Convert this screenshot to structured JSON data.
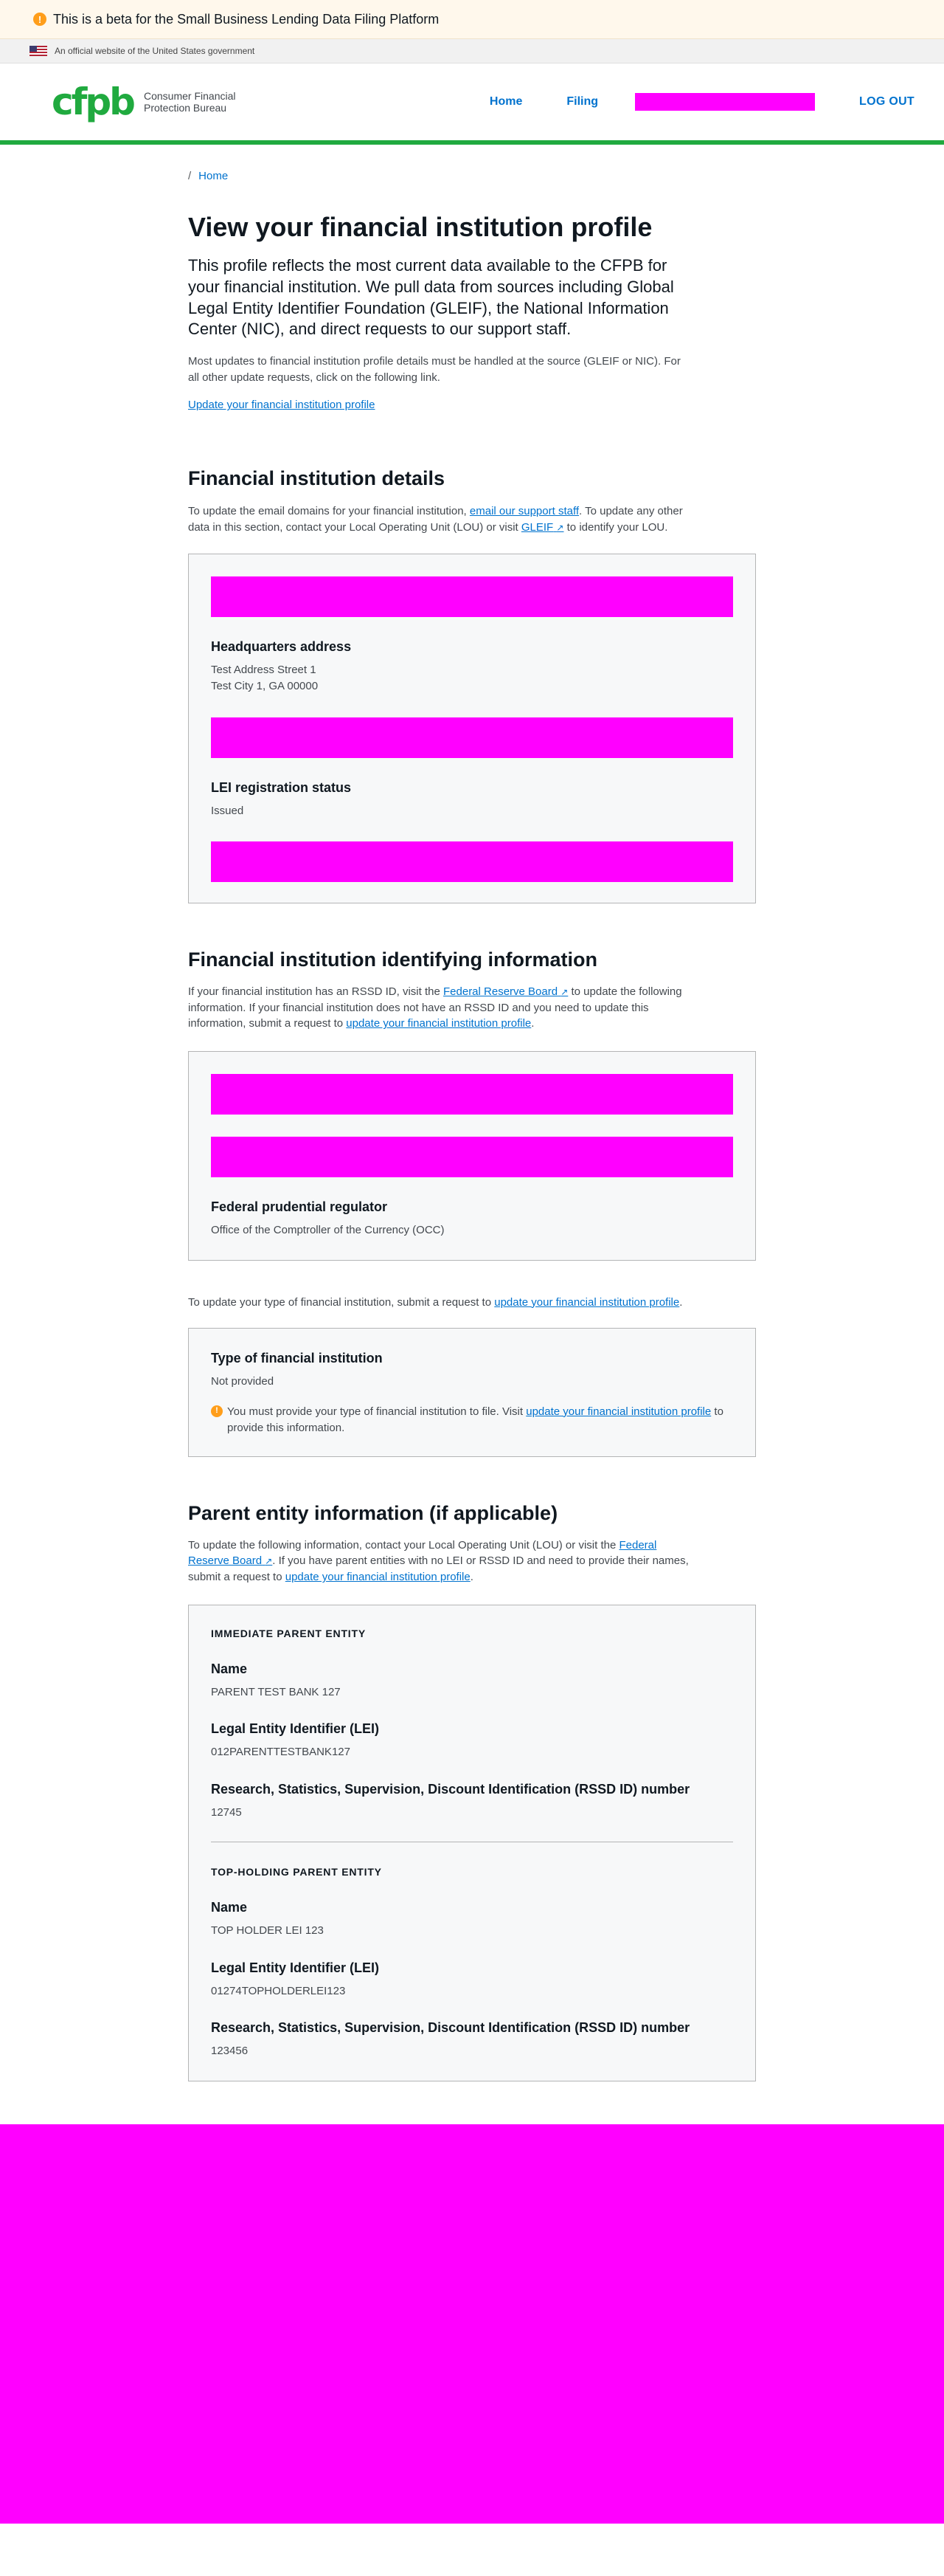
{
  "beta_banner": {
    "icon": "warning-icon",
    "text": "This is a beta for the Small Business Lending Data Filing Platform"
  },
  "gov_banner": {
    "text": "An official website of the United States government"
  },
  "header": {
    "logo": "cfpb",
    "logo_text_line1": "Consumer Financial",
    "logo_text_line2": "Protection Bureau",
    "nav_home": "Home",
    "nav_filing": "Filing",
    "nav_logout": "LOG OUT"
  },
  "breadcrumb": {
    "separator": "/",
    "home": "Home"
  },
  "page": {
    "title": "View your financial institution profile",
    "lead": "This profile reflects the most current data available to the CFPB for your financial institution. We pull data from sources including Global Legal Entity Identifier Foundation (GLEIF), the National Information Center (NIC), and direct requests to our support staff.",
    "intro": "Most updates to financial institution profile details must be handled at the source (GLEIF or NIC). For all other update requests, click on the following link.",
    "update_link": "Update your financial institution profile"
  },
  "fi_details": {
    "title": "Financial institution details",
    "desc_1": "To update the email domains for your financial institution,",
    "desc_link_email": "email our support staff",
    "desc_2": ". To update any other data in this section, contact your Local Operating Unit (LOU) or visit",
    "desc_link_gleif": "GLEIF",
    "desc_3": "to identify your LOU.",
    "hq_label": "Headquarters address",
    "hq_line1": "Test Address Street 1",
    "hq_line2": "Test City 1, GA 00000",
    "lei_status_label": "LEI registration status",
    "lei_status_value": "Issued"
  },
  "fi_identifying": {
    "title": "Financial institution identifying information",
    "desc_1": "If your financial institution has an RSSD ID, visit the",
    "desc_link_frb": "Federal Reserve Board",
    "desc_2": "to update the following information. If your financial institution does not have an RSSD ID and you need to update this information, submit a request to",
    "desc_link_update": "update your financial institution profile",
    "desc_end": ".",
    "regulator_label": "Federal prudential regulator",
    "regulator_value": "Office of the Comptroller of the Currency (OCC)"
  },
  "fi_type": {
    "desc": "To update your type of financial institution, submit a request to",
    "desc_link": "update your financial institution profile",
    "desc_end": ".",
    "label": "Type of financial institution",
    "value": "Not provided",
    "alert_1": "You must provide your type of financial institution to file. Visit",
    "alert_link": "update your financial institution profile",
    "alert_2": "to provide this information."
  },
  "parent": {
    "title": "Parent entity information (if applicable)",
    "desc_1": "To update the following information, contact your Local Operating Unit (LOU) or visit the",
    "desc_link_frb": "Federal Reserve Board",
    "desc_2": ". If you have parent entities with no LEI or RSSD ID and need to provide their names, submit a request to",
    "desc_link_update": "update your financial institution profile",
    "desc_end": ".",
    "immediate": {
      "heading": "IMMEDIATE PARENT ENTITY",
      "name_label": "Name",
      "name_value": "PARENT TEST BANK 127",
      "lei_label": "Legal Entity Identifier (LEI)",
      "lei_value": "012PARENTTESTBANK127",
      "rssd_label": "Research, Statistics, Supervision, Discount Identification (RSSD ID) number",
      "rssd_value": "12745"
    },
    "top_holding": {
      "heading": "TOP-HOLDING PARENT ENTITY",
      "name_label": "Name",
      "name_value": "TOP HOLDER LEI 123",
      "lei_label": "Legal Entity Identifier (LEI)",
      "lei_value": "01274TOPHOLDERLEI123",
      "rssd_label": "Research, Statistics, Supervision, Discount Identification (RSSD ID) number",
      "rssd_value": "123456"
    }
  },
  "icons": {
    "external_link": "external-link-icon",
    "warning": "warning-icon",
    "flag": "us-flag-icon"
  },
  "colors": {
    "brand_green": "#20aa3f",
    "link_blue": "#0072ce",
    "redaction": "#ff00ff",
    "warning_orange": "#ff9e1b"
  }
}
